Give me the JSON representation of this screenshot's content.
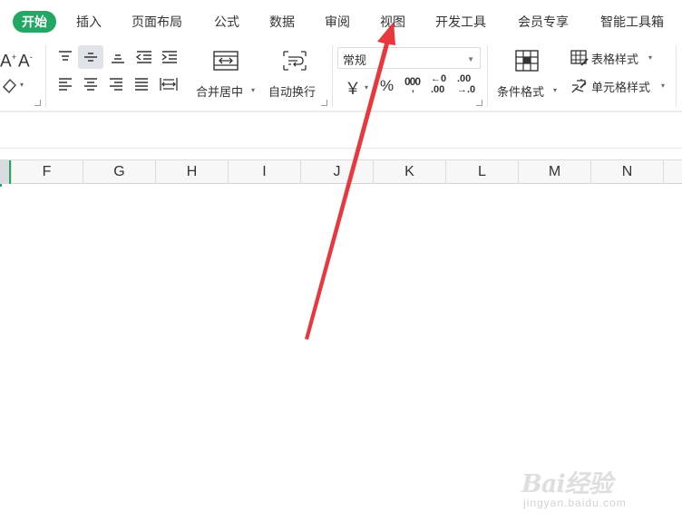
{
  "tabs": [
    {
      "label": "开始",
      "active": true
    },
    {
      "label": "插入"
    },
    {
      "label": "页面布局"
    },
    {
      "label": "公式"
    },
    {
      "label": "数据"
    },
    {
      "label": "审阅"
    },
    {
      "label": "视图"
    },
    {
      "label": "开发工具"
    },
    {
      "label": "会员专享"
    },
    {
      "label": "智能工具箱"
    }
  ],
  "ribbon": {
    "merge_center_label": "合并居中",
    "wrap_text_label": "自动换行",
    "number_format_value": "常规",
    "currency_symbol": "￥",
    "percent_symbol": "%",
    "thousands_symbol": "000",
    "decimal_increase_label": "←0\n.00",
    "decimal_decrease_label": ".00\n→.0",
    "conditional_format_label": "条件格式",
    "table_style_label": "表格样式",
    "cell_style_label": "单元格样式",
    "font_size_glyph": "A"
  },
  "sheet": {
    "columns": [
      "F",
      "G",
      "H",
      "I",
      "J",
      "K",
      "L",
      "M",
      "N"
    ]
  },
  "annotation": {
    "arrow_color": "#e8383d",
    "points_to": "视图"
  },
  "watermark": {
    "brand": "Bai经验",
    "url": "jingyan.baidu.com"
  },
  "colors": {
    "accent": "#23a765",
    "arrow": "#e8383d"
  }
}
